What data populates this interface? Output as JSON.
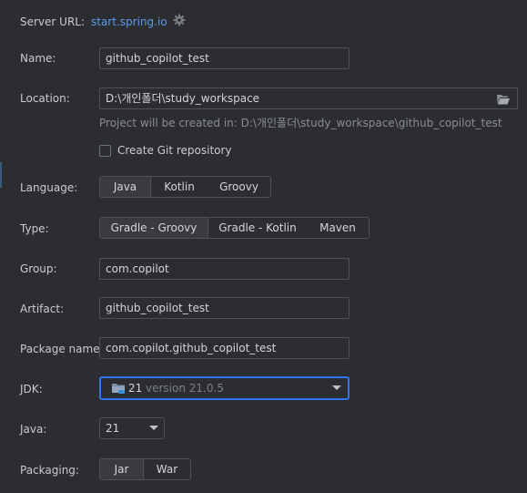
{
  "server": {
    "label": "Server URL:",
    "url": "start.spring.io",
    "settings_icon": "gear-icon"
  },
  "name": {
    "label": "Name:",
    "value": "github_copilot_test"
  },
  "location": {
    "label": "Location:",
    "value": "D:\\개인폴더\\study_workspace",
    "hint": "Project will be created in: D:\\개인폴더\\study_workspace\\github_copilot_test",
    "browse_icon": "folder-open-icon"
  },
  "git": {
    "label": "Create Git repository",
    "checked": false
  },
  "language": {
    "label": "Language:",
    "options": [
      "Java",
      "Kotlin",
      "Groovy"
    ],
    "selected": "Java"
  },
  "type": {
    "label": "Type:",
    "options": [
      "Gradle - Groovy",
      "Gradle - Kotlin",
      "Maven"
    ],
    "selected": "Gradle - Groovy"
  },
  "group": {
    "label": "Group:",
    "value": "com.copilot"
  },
  "artifact": {
    "label": "Artifact:",
    "value": "github_copilot_test"
  },
  "package_name": {
    "label": "Package name:",
    "value": "com.copilot.github_copilot_test"
  },
  "jdk": {
    "label": "JDK:",
    "name": "21",
    "version": "version 21.0.5",
    "icon": "jdk-folder-icon"
  },
  "java": {
    "label": "Java:",
    "value": "21"
  },
  "packaging": {
    "label": "Packaging:",
    "options": [
      "Jar",
      "War"
    ],
    "selected": "Jar"
  },
  "colors": {
    "background": "#2b2d30",
    "link": "#5d9cec",
    "focus": "#3574f0",
    "field_border": "#4e5157",
    "selected_segment": "#393b40"
  }
}
